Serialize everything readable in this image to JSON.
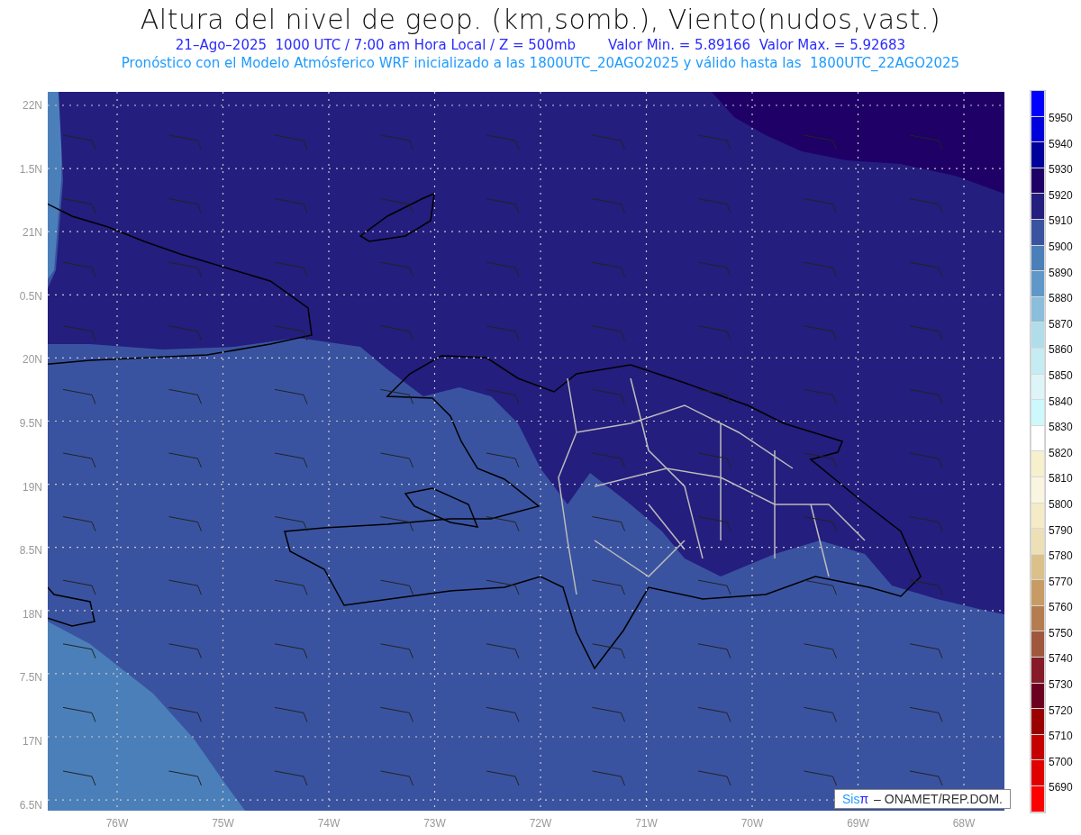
{
  "header": {
    "title": "Altura del nivel de geop. (km,somb.), Viento(nudos,vast.)",
    "date_line": "21–Ago–2025  1000 UTC / 7:00 am Hora Local / Z = 500mb",
    "range_line": "Valor Min. = 5.89166  Valor Max. = 5.92683",
    "model_line": "Pronóstico con el Modelo Atmósferico WRF inicializado a las 1800UTC_20AGO2025 y válido hasta las  1800UTC_22AGO2025"
  },
  "map": {
    "lat_labels": [
      "22N",
      "1.5N",
      "21N",
      "0.5N",
      "20N",
      "9.5N",
      "19N",
      "8.5N",
      "18N",
      "7.5N",
      "17N",
      "6.5N"
    ],
    "lon_labels": [
      "76W",
      "75W",
      "74W",
      "73W",
      "72W",
      "71W",
      "70W",
      "69W",
      "68W"
    ],
    "credit": {
      "brand": "Sis",
      "brand_mark": "π",
      "text": "– ONAMET/REP.DOM."
    }
  },
  "colorbar": {
    "items": [
      {
        "color": "#0000ff",
        "label": "5950"
      },
      {
        "color": "#0000dd",
        "label": "5940"
      },
      {
        "color": "#00009a",
        "label": "5930"
      },
      {
        "color": "#1e0066",
        "label": "5920"
      },
      {
        "color": "#241e7e",
        "label": "5910"
      },
      {
        "color": "#3a53a0",
        "label": "5900"
      },
      {
        "color": "#4b7fb9",
        "label": "5890"
      },
      {
        "color": "#5f98c8",
        "label": "5880"
      },
      {
        "color": "#8bbddc",
        "label": "5870"
      },
      {
        "color": "#b0dde9",
        "label": "5860"
      },
      {
        "color": "#c4ecf2",
        "label": "5850"
      },
      {
        "color": "#ddf5f8",
        "label": "5840"
      },
      {
        "color": "#cdf9fc",
        "label": "5830"
      },
      {
        "color": "#ffffff",
        "label": "5820"
      },
      {
        "color": "#f6f0cc",
        "label": "5810"
      },
      {
        "color": "#faf5e0",
        "label": "5800"
      },
      {
        "color": "#f5ebc6",
        "label": "5790"
      },
      {
        "color": "#ede0b6",
        "label": "5780"
      },
      {
        "color": "#dcc08a",
        "label": "5770"
      },
      {
        "color": "#c89b64",
        "label": "5760"
      },
      {
        "color": "#b57d4f",
        "label": "5750"
      },
      {
        "color": "#a0583d",
        "label": "5740"
      },
      {
        "color": "#861a28",
        "label": "5730"
      },
      {
        "color": "#6b0020",
        "label": "5720"
      },
      {
        "color": "#9a0000",
        "label": "5710"
      },
      {
        "color": "#c40000",
        "label": "5700"
      },
      {
        "color": "#e00000",
        "label": "5690"
      },
      {
        "color": "#ff0000"
      }
    ]
  }
}
